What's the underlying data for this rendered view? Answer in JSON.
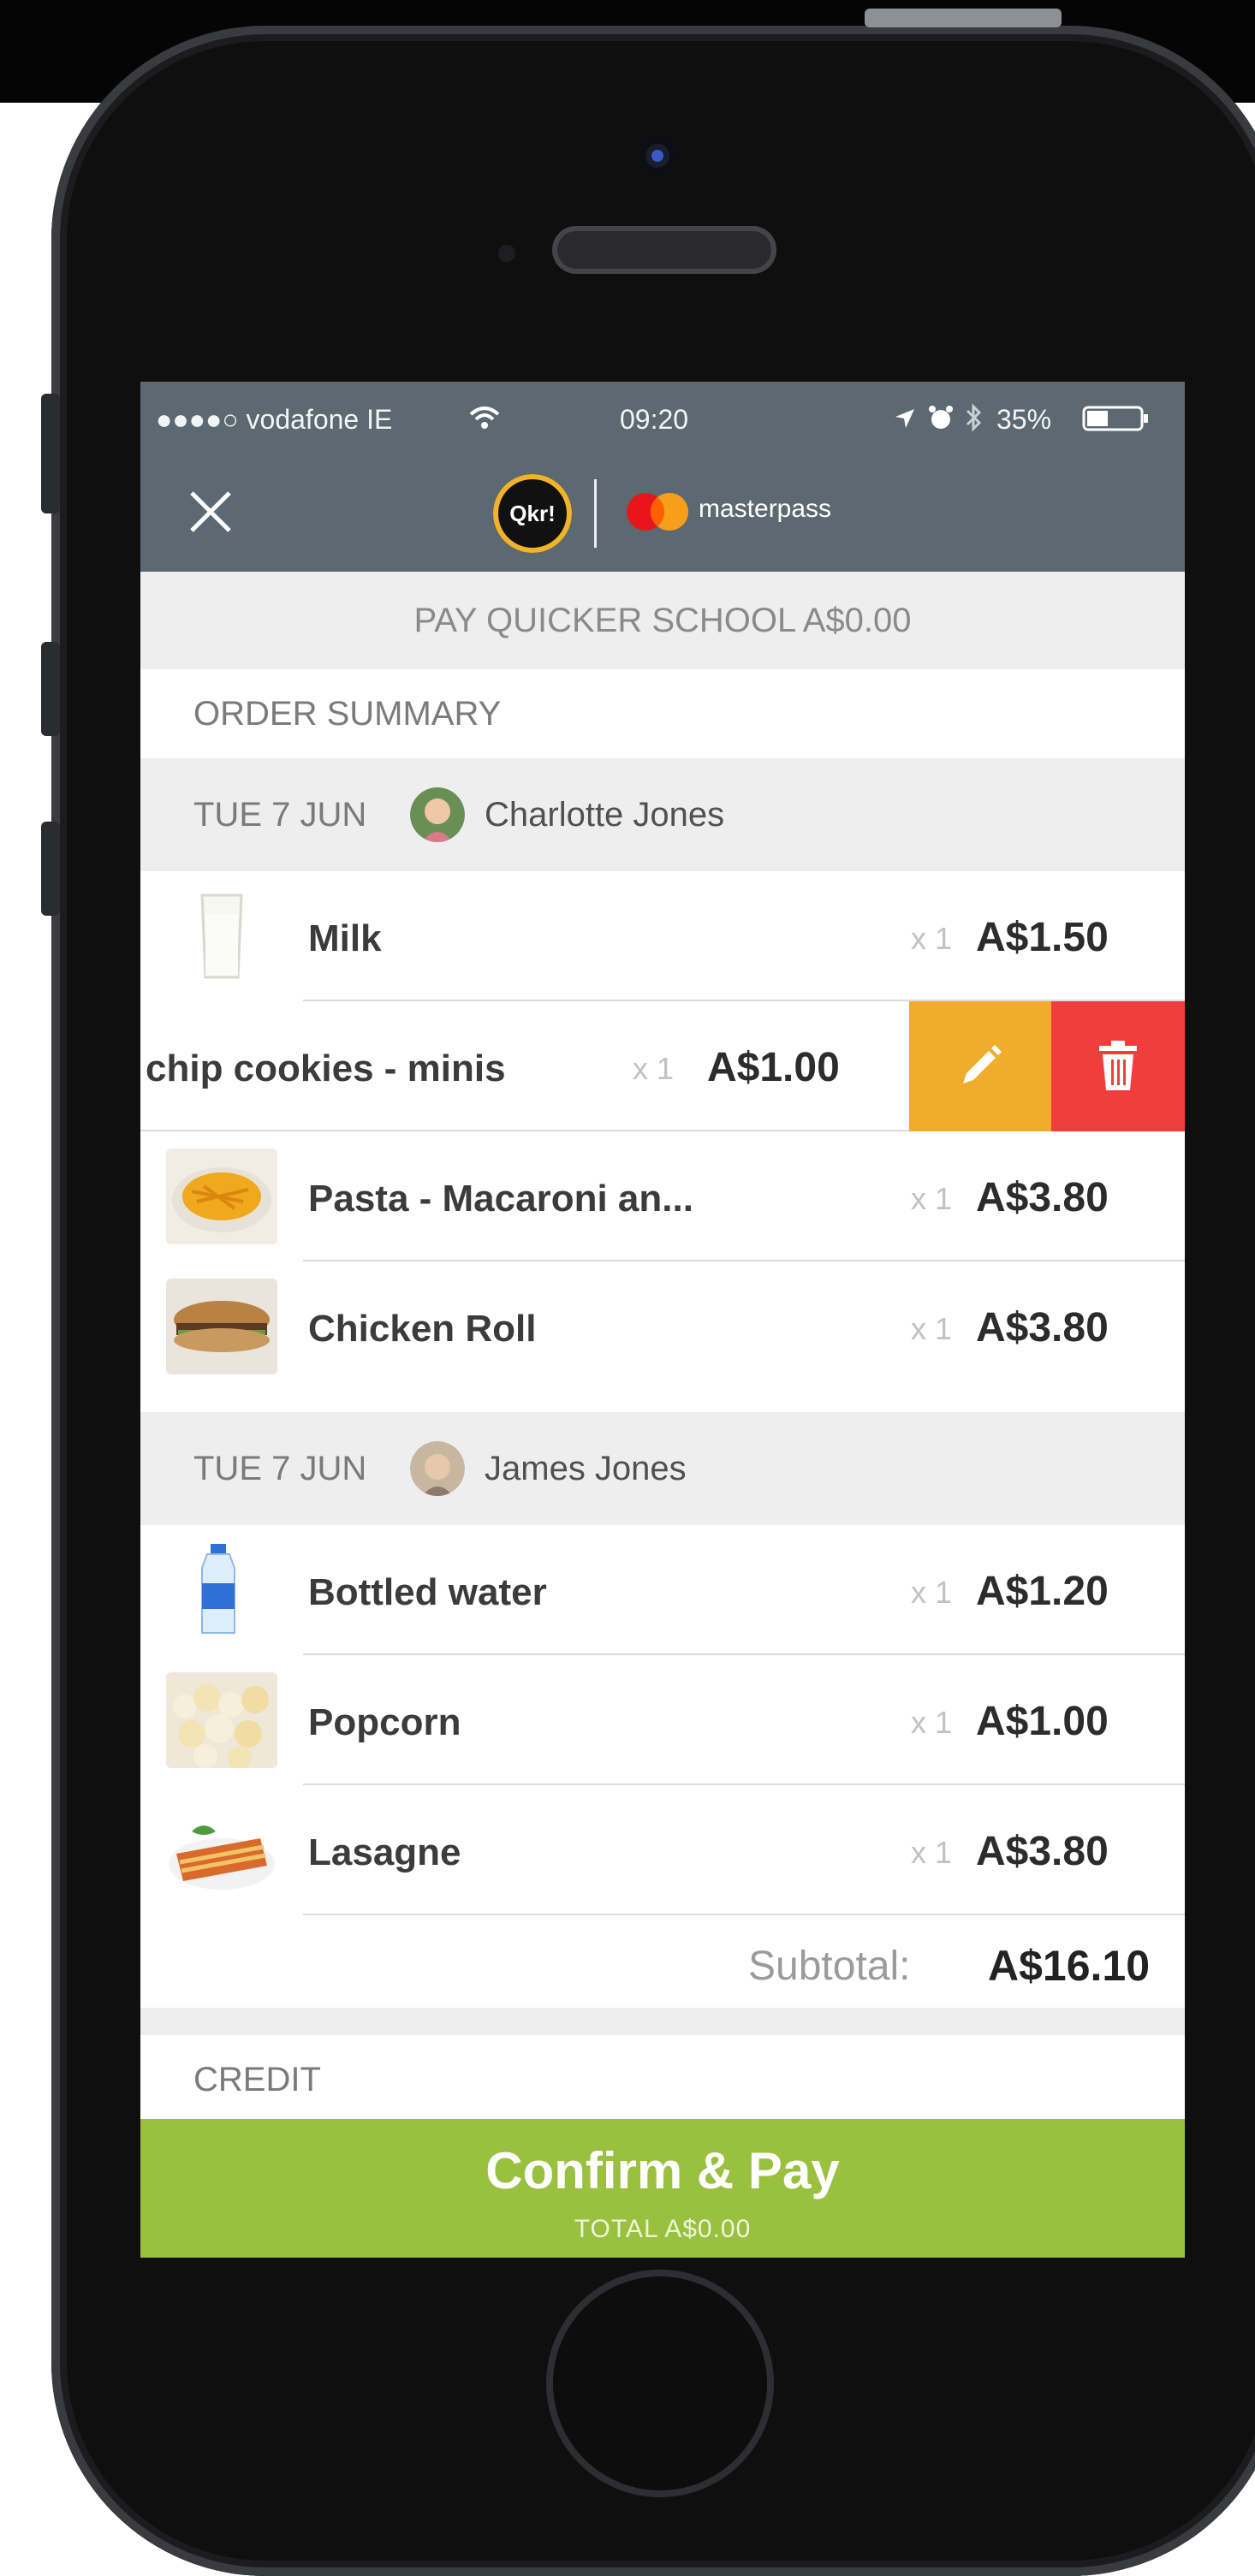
{
  "status_bar": {
    "carrier": "●●●●○ vodafone IE",
    "time": "09:20",
    "battery": "35%"
  },
  "header": {
    "logo_text": "Qkr!",
    "partner": "masterpass"
  },
  "pay_banner": "PAY QUICKER SCHOOL A$0.00",
  "order_summary_label": "ORDER SUMMARY",
  "groups": [
    {
      "date": "TUE 7 JUN",
      "name": "Charlotte  Jones",
      "items": [
        {
          "name": "Milk",
          "qty": "x 1",
          "price": "A$1.50"
        },
        {
          "name": "chip cookies - minis",
          "qty": "x 1",
          "price": "A$1.00"
        },
        {
          "name": "Pasta - Macaroni an...",
          "qty": "x 1",
          "price": "A$3.80"
        },
        {
          "name": "Chicken Roll",
          "qty": "x 1",
          "price": "A$3.80"
        }
      ]
    },
    {
      "date": "TUE 7 JUN",
      "name": "James Jones",
      "items": [
        {
          "name": "Bottled water",
          "qty": "x 1",
          "price": "A$1.20"
        },
        {
          "name": "Popcorn",
          "qty": "x 1",
          "price": "A$1.00"
        },
        {
          "name": "Lasagne",
          "qty": "x 1",
          "price": "A$3.80"
        }
      ]
    }
  ],
  "subtotal": {
    "label": "Subtotal:",
    "value": "A$16.10"
  },
  "credit_label": "CREDIT",
  "confirm": {
    "label": "Confirm & Pay",
    "total": "TOTAL A$0.00"
  },
  "colors": {
    "appbar": "#5c6971",
    "accent_green": "#9ac03f",
    "edit_orange": "#f0ad2b",
    "delete_red": "#f23d3d"
  },
  "icons": [
    "close-icon",
    "wifi-icon",
    "location-icon",
    "alarm-icon",
    "bluetooth-icon",
    "battery-icon",
    "pencil-icon",
    "trash-icon"
  ]
}
